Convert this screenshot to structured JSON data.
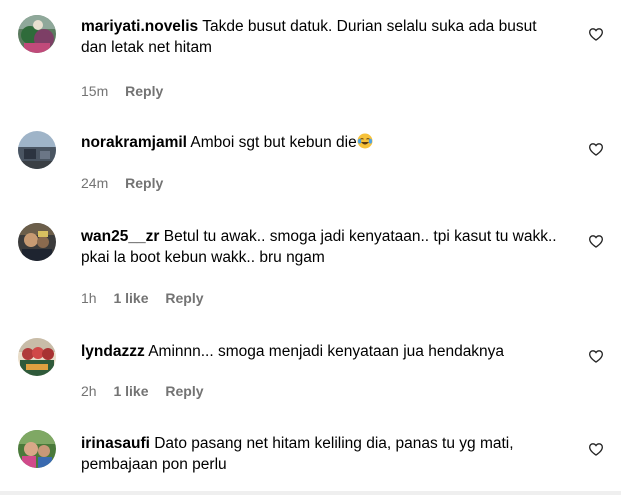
{
  "comments": [
    {
      "username": "mariyati.novelis",
      "text": "Takde busut datuk. Durian selalu suka ada busut dan letak net hitam",
      "time": "15m",
      "likes": "",
      "reply_label": "Reply",
      "avatar_icon": "user-avatar"
    },
    {
      "username": "norakramjamil",
      "text": "Amboi sgt but kebun die",
      "emoji": "face-with-tears-of-joy",
      "time": "24m",
      "likes": "",
      "reply_label": "Reply",
      "avatar_icon": "user-avatar"
    },
    {
      "username": "wan25__zr",
      "text": "Betul tu awak.. smoga jadi kenyataan.. tpi kasut tu wakk.. pkai la boot kebun wakk.. bru ngam",
      "time": "1h",
      "likes": "1 like",
      "reply_label": "Reply",
      "avatar_icon": "user-avatar"
    },
    {
      "username": "lyndazzz",
      "text": "Aminnn... smoga menjadi kenyataan jua hendaknya",
      "time": "2h",
      "likes": "1 like",
      "reply_label": "Reply",
      "avatar_icon": "user-avatar"
    },
    {
      "username": "irinasaufi",
      "text": "Dato pasang net hitam keliling dia, panas tu yg mati, pembajaan pon perlu",
      "time": "",
      "likes": "",
      "reply_label": "",
      "avatar_icon": "user-avatar"
    }
  ],
  "icons": {
    "like": "heart-outline-icon"
  },
  "colors": {
    "text": "#000000",
    "meta": "#737373",
    "background": "#ffffff"
  }
}
